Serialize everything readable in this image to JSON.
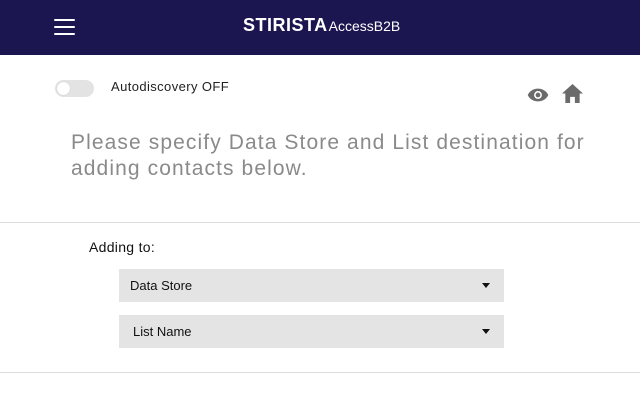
{
  "header": {
    "brand_main": "STIRISTA",
    "brand_sub": "AccessB2B",
    "menu_icon": "hamburger-menu-icon",
    "background_color": "#1c1650"
  },
  "toolbar": {
    "toggle_state": "off",
    "toggle_label": "Autodiscovery OFF",
    "eye_icon": "eye-icon",
    "home_icon": "home-icon"
  },
  "main": {
    "instruction": "Please specify Data Store and List destination for adding contacts below.",
    "adding_label": "Adding to:",
    "data_store_select": {
      "selected": "Data Store"
    },
    "list_name_select": {
      "selected": "List Name"
    }
  }
}
